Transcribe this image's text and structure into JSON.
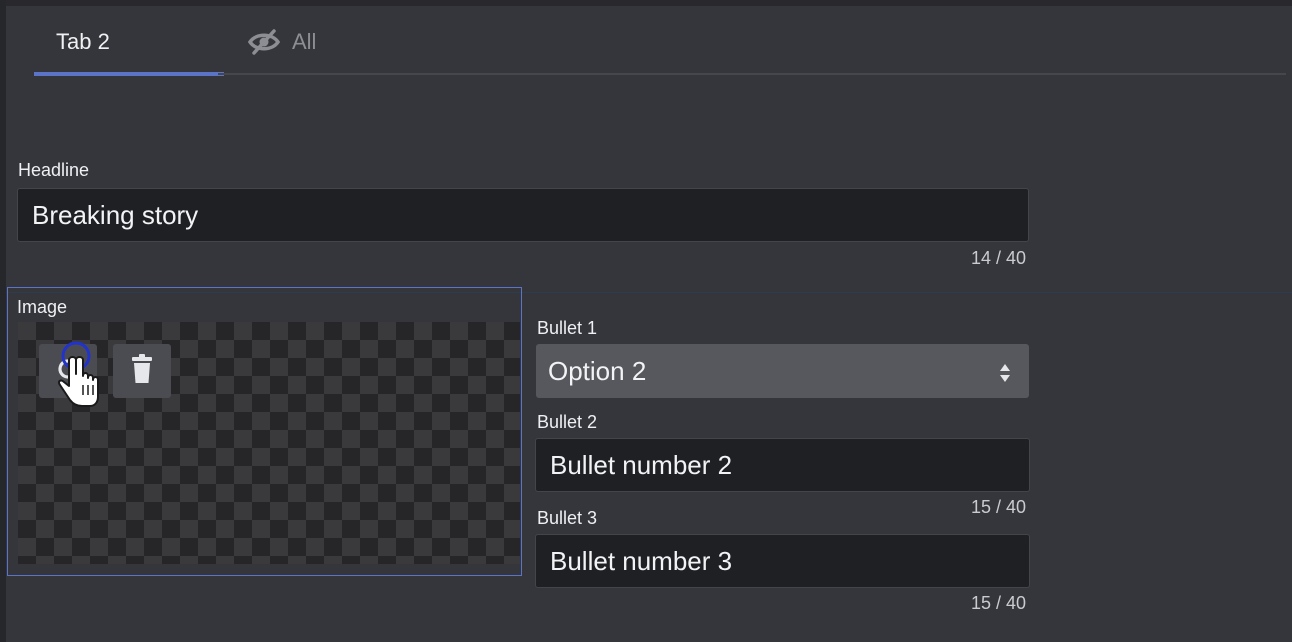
{
  "tabs": [
    {
      "label": "Tab 2",
      "active": true,
      "icon": null
    },
    {
      "label": "All",
      "active": false,
      "icon": "eye-off-icon"
    }
  ],
  "headline": {
    "label": "Headline",
    "value": "Breaking story",
    "counter": "14 / 40"
  },
  "image": {
    "label": "Image",
    "buttons": [
      {
        "name": "refresh-image-button",
        "icon": "refresh-icon"
      },
      {
        "name": "delete-image-button",
        "icon": "trash-icon"
      }
    ]
  },
  "bullet1": {
    "label": "Bullet 1",
    "value": "Option 2"
  },
  "bullet2": {
    "label": "Bullet 2",
    "value": "Bullet number 2",
    "counter": "15 / 40"
  },
  "bullet3": {
    "label": "Bullet 3",
    "value": "Bullet number 3",
    "counter": "15 / 40"
  },
  "colors": {
    "accent": "#5b74c8",
    "background": "#35363b",
    "input_background": "#1f2024",
    "select_background": "#57585d"
  }
}
